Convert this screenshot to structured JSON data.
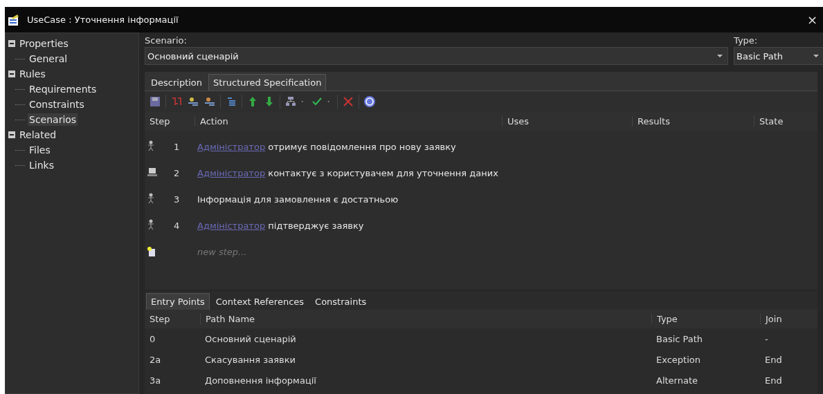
{
  "window": {
    "title": "UseCase : Уточнення інформації",
    "close": "×"
  },
  "tree": [
    {
      "label": "Properties",
      "expanded": true,
      "selected": false,
      "children": [
        {
          "label": "General",
          "selected": false
        }
      ]
    },
    {
      "label": "Rules",
      "expanded": true,
      "selected": false,
      "children": [
        {
          "label": "Requirements",
          "selected": false
        },
        {
          "label": "Constraints",
          "selected": false
        },
        {
          "label": "Scenarios",
          "selected": true
        }
      ]
    },
    {
      "label": "Related",
      "expanded": true,
      "selected": false,
      "children": [
        {
          "label": "Files",
          "selected": false
        },
        {
          "label": "Links",
          "selected": false
        }
      ]
    }
  ],
  "scenario": {
    "label": "Scenario:",
    "value": "Основний сценарій"
  },
  "type": {
    "label": "Type:",
    "value": "Basic Path"
  },
  "tabs": [
    {
      "label": "Description",
      "selected": false
    },
    {
      "label": "Structured Specification",
      "selected": true
    }
  ],
  "steps_table": {
    "columns": [
      "Step",
      "Action",
      "Uses",
      "Results",
      "State"
    ],
    "rows": [
      {
        "kind": "actor",
        "step": "1",
        "actor": "Адміністратор",
        "text": "отримує повідомлення про нову заявку"
      },
      {
        "kind": "system",
        "step": "2",
        "actor": "Адміністратор",
        "text": "контактує з користувачем для уточнення даних"
      },
      {
        "kind": "actor",
        "step": "3",
        "text": "Інформація для замовлення є достатньою"
      },
      {
        "kind": "actor",
        "step": "4",
        "actor": "Адміністратор",
        "text": "підтверджує заявку"
      }
    ],
    "new_step": "new step..."
  },
  "bottom_tabs": [
    {
      "label": "Entry Points",
      "selected": true
    },
    {
      "label": "Context References",
      "selected": false
    },
    {
      "label": "Constraints",
      "selected": false
    }
  ],
  "entry_table": {
    "columns": [
      "Step",
      "Path Name",
      "Type",
      "Join"
    ],
    "rows": [
      [
        "0",
        "Основний сценарій",
        "Basic Path",
        "-"
      ],
      [
        "2a",
        "Скасування заявки",
        "Exception",
        "End"
      ],
      [
        "3a",
        "Доповнення інформації",
        "Alternate",
        "End"
      ]
    ]
  }
}
